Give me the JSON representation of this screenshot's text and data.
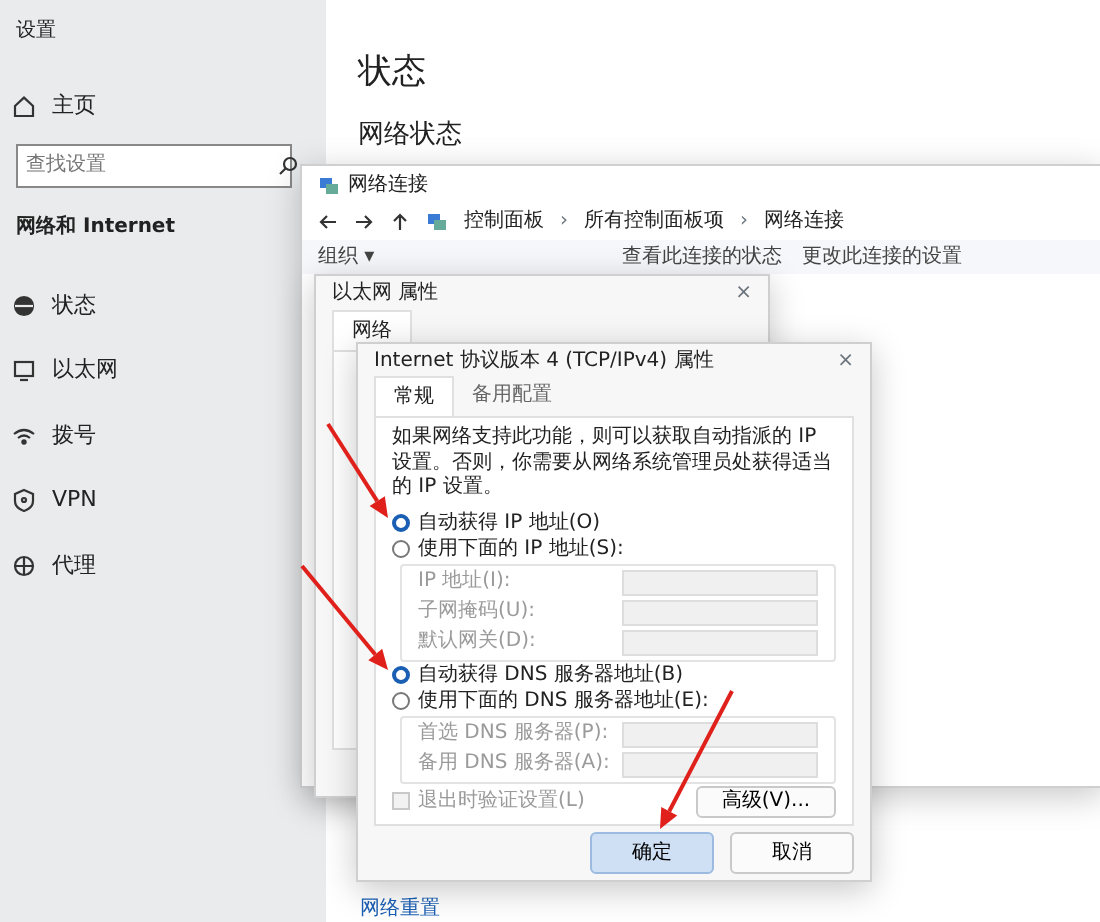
{
  "settings": {
    "title": "设置",
    "home": "主页",
    "search": {
      "placeholder": "查找设置"
    },
    "section": "网络和 Internet",
    "nav": [
      {
        "label": "状态"
      },
      {
        "label": "以太网"
      },
      {
        "label": "拨号"
      },
      {
        "label": "VPN"
      },
      {
        "label": "代理"
      }
    ],
    "page_title": "状态",
    "subtitle": "网络状态",
    "reset_link": "网络重置"
  },
  "connections_window": {
    "title": "网络连接",
    "breadcrumb": [
      "控制面板",
      "所有控制面板项",
      "网络连接"
    ],
    "separator": "›",
    "toolbar": [
      "组织 ▾",
      "查看此连接的状态",
      "更改此连接的设置"
    ]
  },
  "ethernet_window": {
    "title": "以太网 属性",
    "close": "×",
    "tabs": [
      {
        "label": "网络",
        "selected": true
      }
    ]
  },
  "ipv4_dialog": {
    "title": "Internet 协议版本 4 (TCP/IPv4) 属性",
    "close": "×",
    "tabs": [
      {
        "label": "常规",
        "selected": true
      },
      {
        "label": "备用配置",
        "selected": false
      }
    ],
    "description": "如果网络支持此功能，则可以获取自动指派的 IP 设置。否则，你需要从网络系统管理员处获得适当的 IP 设置。",
    "ip_options": [
      {
        "label": "自动获得 IP 地址(O)",
        "selected": true
      },
      {
        "label": "使用下面的 IP 地址(S):",
        "selected": false
      }
    ],
    "ip_fields": [
      {
        "label": "IP 地址(I):",
        "disabled": true
      },
      {
        "label": "子网掩码(U):",
        "disabled": true
      },
      {
        "label": "默认网关(D):",
        "disabled": true
      }
    ],
    "dns_options": [
      {
        "label": "自动获得 DNS 服务器地址(B)",
        "selected": true
      },
      {
        "label": "使用下面的 DNS 服务器地址(E):",
        "selected": false
      }
    ],
    "dns_fields": [
      {
        "label": "首选 DNS 服务器(P):",
        "disabled": true
      },
      {
        "label": "备用 DNS 服务器(A):",
        "disabled": true
      }
    ],
    "validate": {
      "label": "退出时验证设置(L)",
      "checked": false,
      "disabled": true
    },
    "advanced": "高级(V)...",
    "buttons": [
      {
        "label": "确定",
        "kind": "primary"
      },
      {
        "label": "取消",
        "kind": "secondary"
      }
    ]
  }
}
